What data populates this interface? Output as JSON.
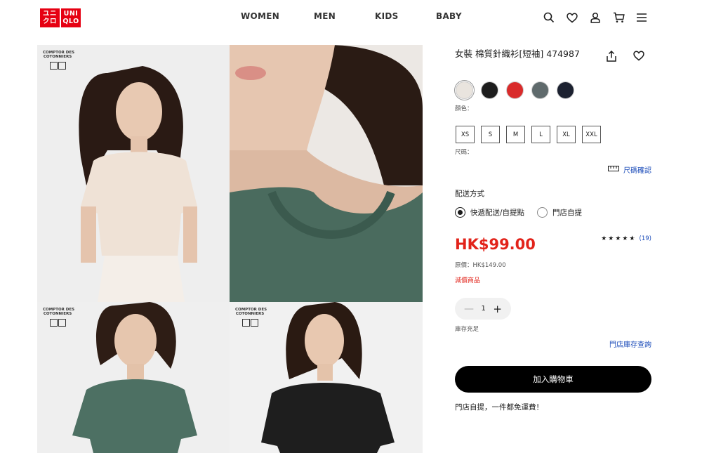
{
  "header": {
    "logo_top": "ユニ\nクロ",
    "logo_right": "UNI\nQLO",
    "nav": [
      "WOMEN",
      "MEN",
      "KIDS",
      "BABY"
    ]
  },
  "gallery": {
    "brand_tag": "COMPTOR DES\nCOTONNIERS",
    "mini_logo_left": "ユニクロ",
    "mini_logo_right": "UNIQLO"
  },
  "product": {
    "title": "女裝 棉質針織衫[短袖] 474987",
    "color_label": "顏色：",
    "colors": [
      "#e9e4de",
      "#1d1d1d",
      "#d92b2b",
      "#5f6a6c",
      "#1c2130"
    ],
    "size_label": "尺碼：",
    "sizes": [
      "XS",
      "S",
      "M",
      "L",
      "XL",
      "XXL"
    ],
    "size_check": "尺碼確認",
    "shipping_title": "配送方式",
    "shipping_options": [
      "快遞配送/自提點",
      "門店自提"
    ],
    "price": "HK$99.00",
    "rating_count": "(19)",
    "rating_value": 4.5,
    "original_price": "原價：HK$149.00",
    "sale_label": "減價商品",
    "quantity": "1",
    "stock_status": "庫存充足",
    "store_stock_link": "門店庫存查詢",
    "add_to_cart": "加入購物車",
    "pickup_note": "門店自提，一件都免運費！"
  }
}
